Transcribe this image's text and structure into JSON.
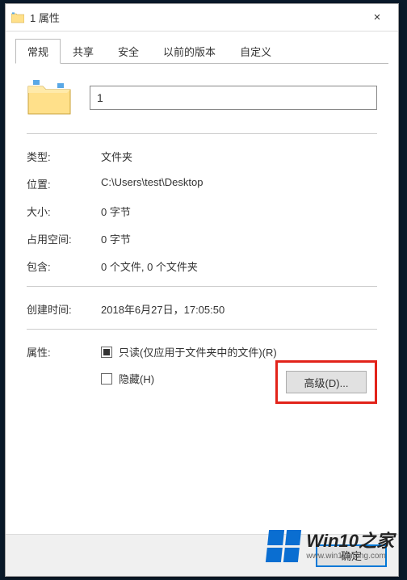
{
  "window": {
    "title": "1 属性",
    "close_label": "×"
  },
  "tabs": [
    {
      "label": "常规",
      "active": true
    },
    {
      "label": "共享",
      "active": false
    },
    {
      "label": "安全",
      "active": false
    },
    {
      "label": "以前的版本",
      "active": false
    },
    {
      "label": "自定义",
      "active": false
    }
  ],
  "general": {
    "name_value": "1",
    "type_label": "类型:",
    "type_value": "文件夹",
    "location_label": "位置:",
    "location_value": "C:\\Users\\test\\Desktop",
    "size_label": "大小:",
    "size_value": "0 字节",
    "size_on_disk_label": "占用空间:",
    "size_on_disk_value": "0 字节",
    "contains_label": "包含:",
    "contains_value": "0 个文件, 0 个文件夹",
    "created_label": "创建时间:",
    "created_value": "2018年6月27日，17:05:50",
    "attributes_label": "属性:",
    "readonly_label": "只读(仅应用于文件夹中的文件)(R)",
    "hidden_label": "隐藏(H)",
    "advanced_label": "高级(D)..."
  },
  "footer": {
    "ok_label": "确定"
  },
  "watermark": {
    "main": "Win10之家",
    "sub": "www.win10xitong.com"
  }
}
